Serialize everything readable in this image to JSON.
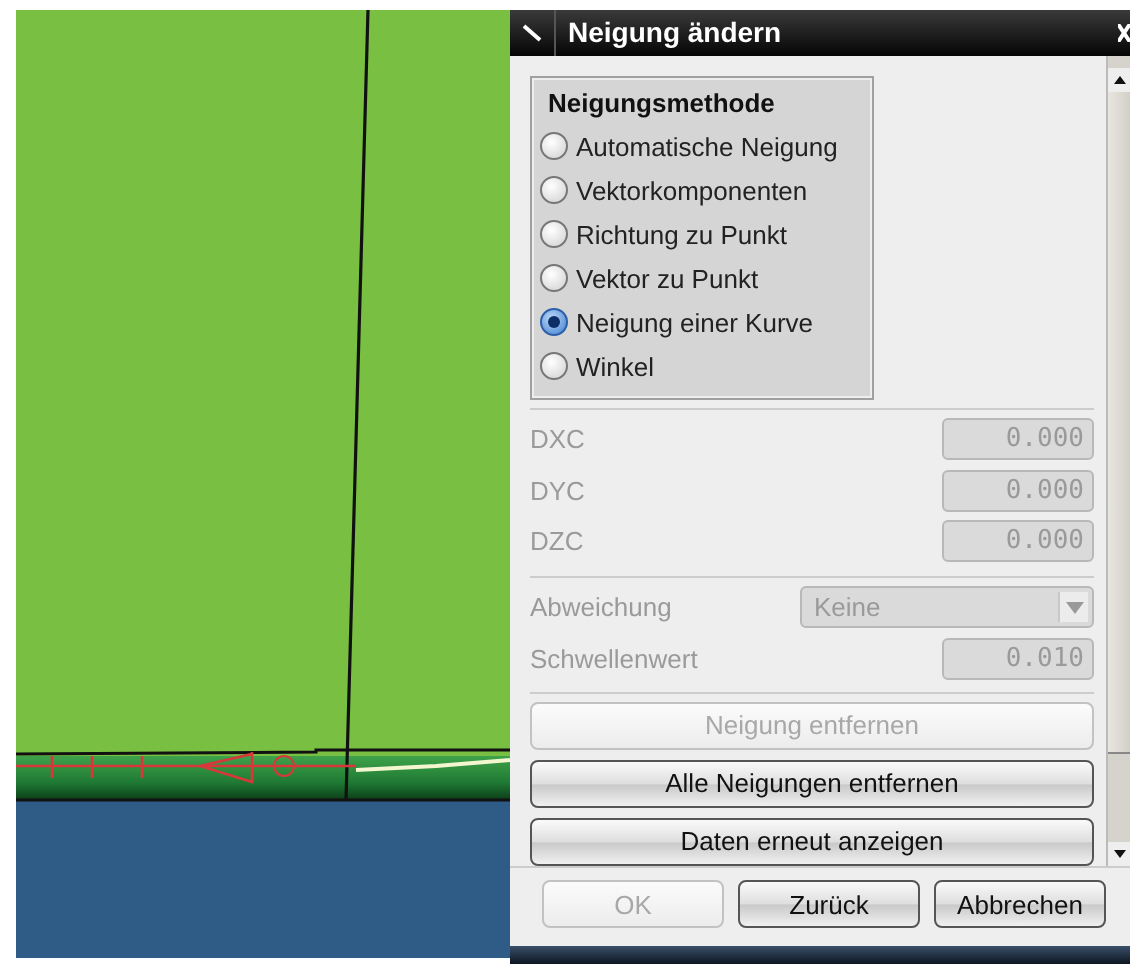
{
  "window": {
    "title": "Neigung ändern"
  },
  "method_group": {
    "title": "Neigungsmethode",
    "options": [
      {
        "label": "Automatische Neigung",
        "selected": false
      },
      {
        "label": "Vektorkomponenten",
        "selected": false
      },
      {
        "label": "Richtung zu Punkt",
        "selected": false
      },
      {
        "label": "Vektor zu Punkt",
        "selected": false
      },
      {
        "label": "Neigung einer Kurve",
        "selected": true
      },
      {
        "label": "Winkel",
        "selected": false
      }
    ]
  },
  "vector_fields": [
    {
      "label": "DXC",
      "value": "0.000",
      "disabled": true
    },
    {
      "label": "DYC",
      "value": "0.000",
      "disabled": true
    },
    {
      "label": "DZC",
      "value": "0.000",
      "disabled": true
    }
  ],
  "options_fields": [
    {
      "kind": "dropdown",
      "label": "Abweichung",
      "value": "Keine",
      "disabled": true
    },
    {
      "kind": "number",
      "label": "Schwellenwert",
      "value": "0.010",
      "disabled": true
    }
  ],
  "actions": [
    {
      "label": "Neigung entfernen",
      "disabled": true
    },
    {
      "label": "Alle Neigungen entfernen",
      "disabled": false
    },
    {
      "label": "Daten erneut anzeigen",
      "disabled": false
    }
  ],
  "footer_buttons": [
    {
      "label": "OK",
      "disabled": true
    },
    {
      "label": "Zurück",
      "disabled": false
    },
    {
      "label": "Abbrechen",
      "disabled": false
    }
  ]
}
